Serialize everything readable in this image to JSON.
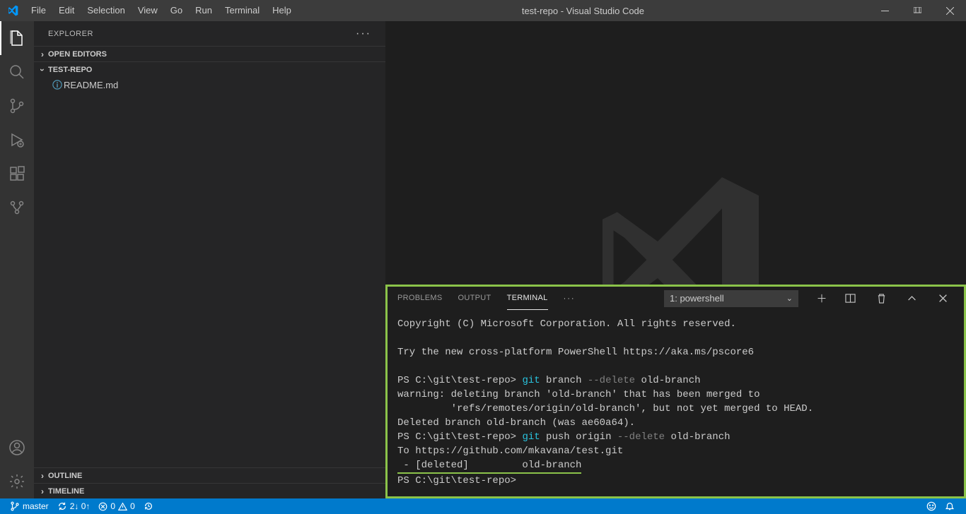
{
  "window": {
    "title": "test-repo - Visual Studio Code"
  },
  "menus": [
    "File",
    "Edit",
    "Selection",
    "View",
    "Go",
    "Run",
    "Terminal",
    "Help"
  ],
  "explorer": {
    "title": "EXPLORER",
    "sections": {
      "open_editors": "OPEN EDITORS",
      "folder": "TEST-REPO",
      "outline": "OUTLINE",
      "timeline": "TIMELINE"
    },
    "files": [
      {
        "name": "README.md",
        "icon": "info-icon"
      }
    ]
  },
  "panel": {
    "tabs": {
      "problems": "PROBLEMS",
      "output": "OUTPUT",
      "terminal": "TERMINAL"
    },
    "selector": "1: powershell"
  },
  "terminal": {
    "l1": "Copyright (C) Microsoft Corporation. All rights reserved.",
    "l2": "Try the new cross-platform PowerShell https://aka.ms/pscore6",
    "prompt1_pre": "PS C:\\git\\test-repo> ",
    "git1": "git",
    "cmd1_a": " branch ",
    "cmd1_flag": "--delete",
    "cmd1_b": " old-branch",
    "warn1": "warning: deleting branch 'old-branch' that has been merged to",
    "warn2": "         'refs/remotes/origin/old-branch', but not yet merged to HEAD.",
    "del1": "Deleted branch old-branch (was ae60a64).",
    "prompt2_pre": "PS C:\\git\\test-repo> ",
    "git2": "git",
    "cmd2_a": " push origin ",
    "cmd2_flag": "--delete",
    "cmd2_b": " old-branch",
    "to": "To https://github.com/mkavana/test.git",
    "deleted_line": " - [deleted]         old-branch",
    "prompt3": "PS C:\\git\\test-repo>"
  },
  "status": {
    "branch": "master",
    "sync": "2↓ 0↑",
    "errors": "0",
    "warnings": "0"
  }
}
